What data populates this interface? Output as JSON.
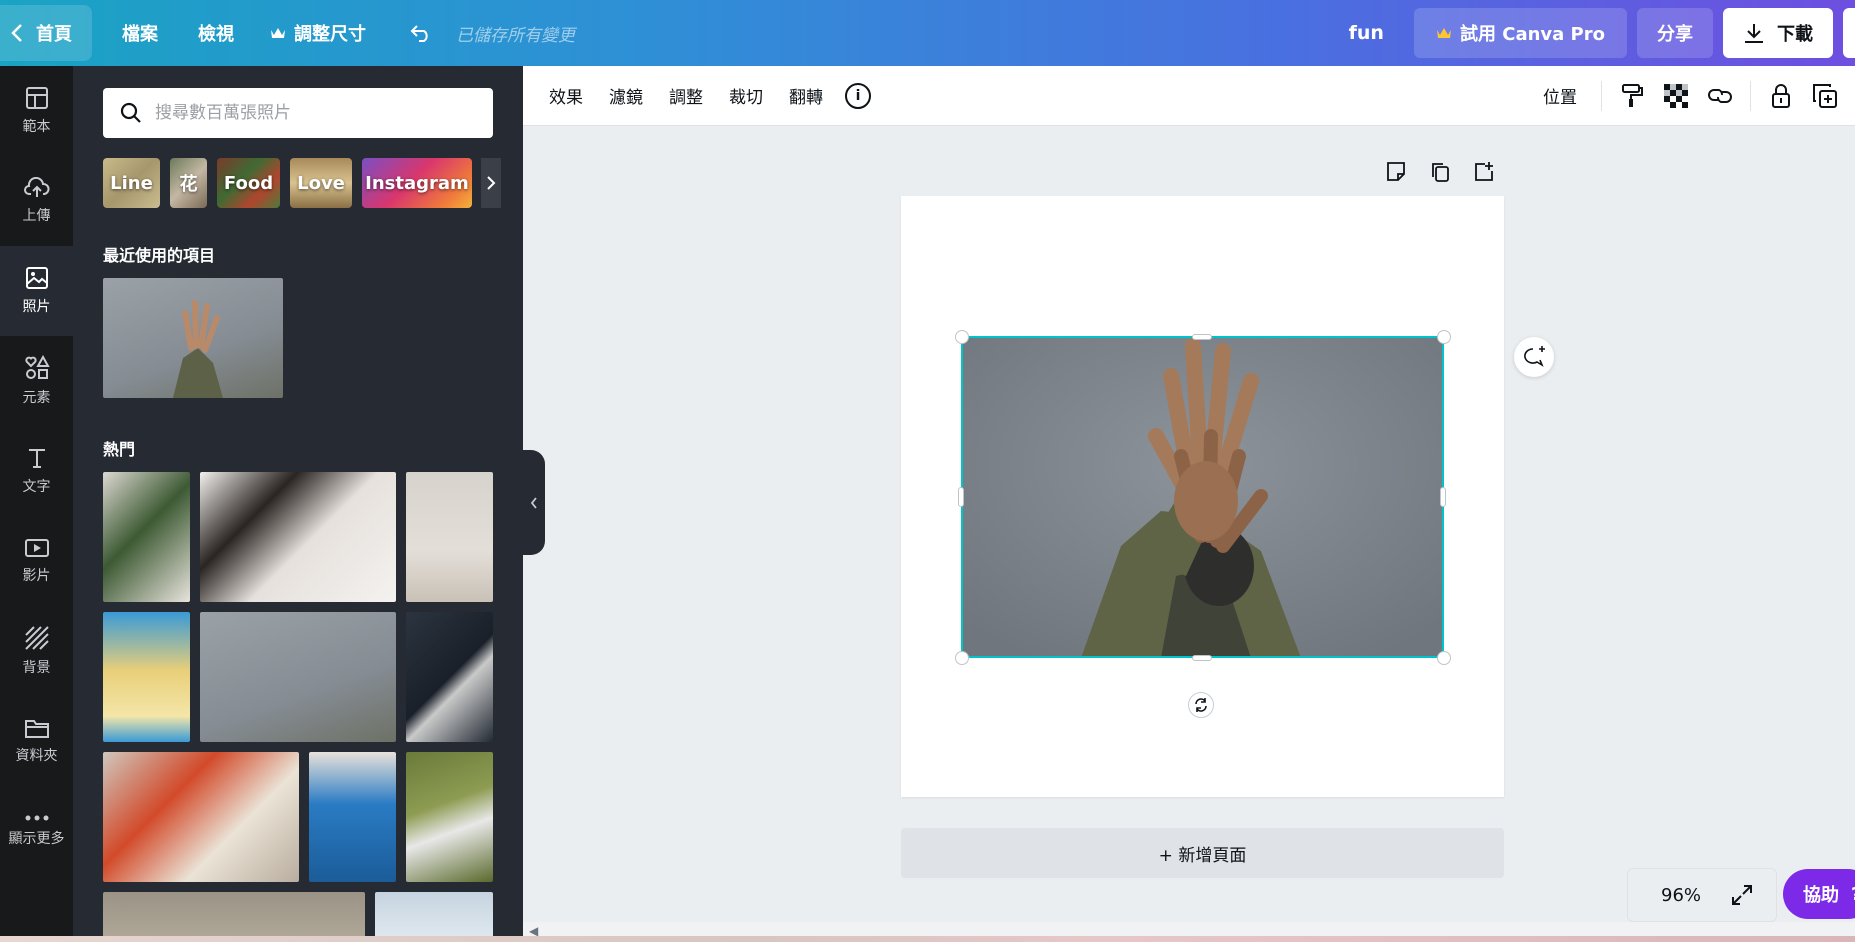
{
  "topbar": {
    "home_label": "首頁",
    "menu": [
      "檔案",
      "檢視",
      "調整尺寸"
    ],
    "saved_status": "已儲存所有變更",
    "design_title": "fun",
    "pro_label": "試用 Canva Pro",
    "share_label": "分享",
    "download_label": "下載"
  },
  "rail": {
    "items": [
      {
        "label": "範本",
        "icon": "template-icon"
      },
      {
        "label": "上傳",
        "icon": "upload-icon"
      },
      {
        "label": "照片",
        "icon": "photo-icon"
      },
      {
        "label": "元素",
        "icon": "elements-icon"
      },
      {
        "label": "文字",
        "icon": "text-icon"
      },
      {
        "label": "影片",
        "icon": "video-icon"
      },
      {
        "label": "背景",
        "icon": "background-icon"
      },
      {
        "label": "資料夾",
        "icon": "folder-icon"
      },
      {
        "label": "顯示更多",
        "icon": "more-icon"
      }
    ],
    "active_index": 2
  },
  "panel": {
    "search_placeholder": "搜尋數百萬張照片",
    "chips": [
      "Line",
      "花",
      "Food",
      "Love",
      "Instagram"
    ],
    "recent_title": "最近使用的項目",
    "popular_title": "熱門"
  },
  "context_toolbar": {
    "items": [
      "效果",
      "濾鏡",
      "調整",
      "裁切",
      "翻轉"
    ],
    "info_label": "i",
    "position_label": "位置"
  },
  "canvas": {
    "add_page_label": "+ 新增頁面"
  },
  "footer": {
    "zoom": "96%",
    "help_label": "協助",
    "help_icon": "?"
  },
  "colors": {
    "selection": "#00c4cc",
    "help": "#7d2ae8",
    "panel": "#252a33",
    "rail": "#18191b"
  }
}
